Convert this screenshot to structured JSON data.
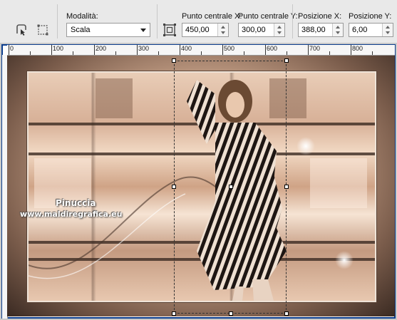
{
  "toolbar": {
    "mode_label": "Modalità:",
    "mode_value": "Scala",
    "center_x_label": "Punto centrale X:",
    "center_x_value": "450,00",
    "center_y_label": "Punto centrale Y:",
    "center_y_value": "300,00",
    "pos_x_label": "Posizione X:",
    "pos_x_value": "388,00",
    "pos_y_label": "Posizione Y:",
    "pos_y_value": "6,00"
  },
  "ruler": {
    "labels": [
      "0",
      "100",
      "200",
      "300",
      "400",
      "500",
      "600",
      "700",
      "800"
    ]
  },
  "canvas": {
    "watermark_name": "Pinuccia",
    "watermark_url": "www.maldiregrafica.eu"
  },
  "colors": {
    "frame_border": "#0a3c8c",
    "toolbar_bg": "#e9e9e9",
    "image_tone": "#cfa98f"
  },
  "icons": [
    "pick-tool-icon",
    "scale-tool-icon",
    "center-icon"
  ]
}
